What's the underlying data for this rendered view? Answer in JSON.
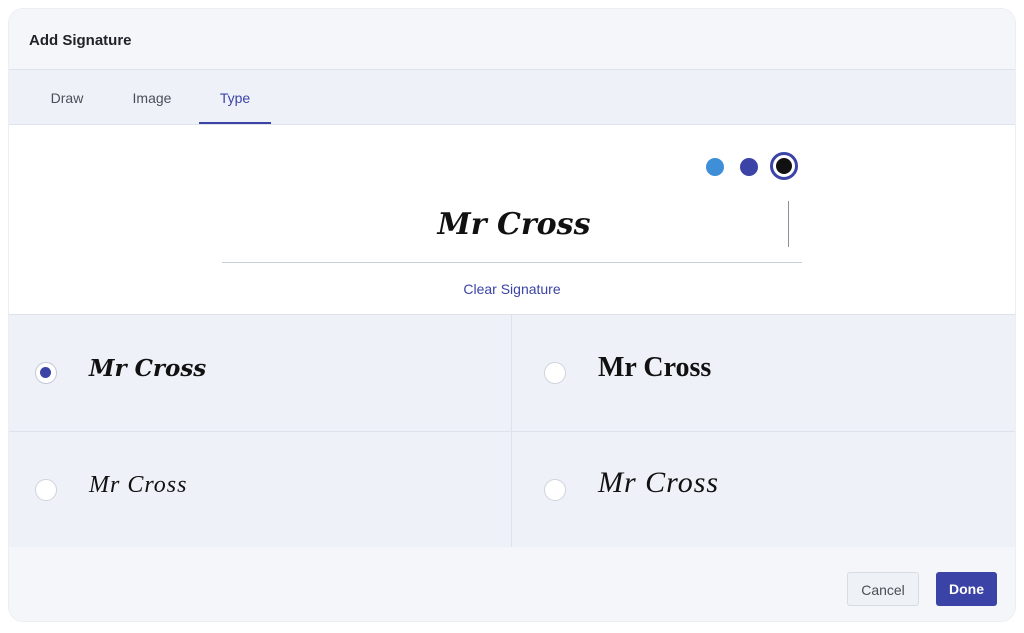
{
  "dialog": {
    "title": "Add Signature"
  },
  "tabs": [
    {
      "label": "Draw",
      "active": false
    },
    {
      "label": "Image",
      "active": false
    },
    {
      "label": "Type",
      "active": true
    }
  ],
  "colors": {
    "accent": "#3b44a6",
    "options": [
      {
        "name": "light-blue",
        "hex": "#3f8fd8",
        "selected": false
      },
      {
        "name": "indigo",
        "hex": "#3b44a6",
        "selected": false
      },
      {
        "name": "black",
        "hex": "#111111",
        "selected": true
      }
    ]
  },
  "signature_input": {
    "value": "Mr Cross"
  },
  "clear_label": "Clear Signature",
  "font_options": [
    {
      "label": "Mr Cross",
      "selected": true
    },
    {
      "label": "Mr Cross",
      "selected": false
    },
    {
      "label": "Mr Cross",
      "selected": false
    },
    {
      "label": "Mr Cross",
      "selected": false
    }
  ],
  "footer": {
    "cancel_label": "Cancel",
    "done_label": "Done"
  }
}
